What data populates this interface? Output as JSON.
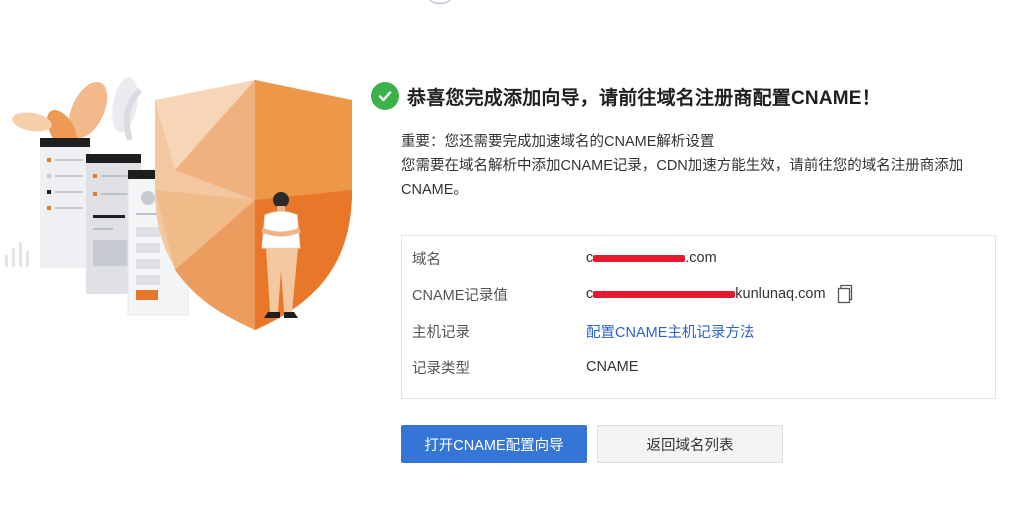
{
  "header": {
    "title": "恭喜您完成添加向导，请前往域名注册商配置CNAME！"
  },
  "notice": {
    "line1": "重要：您还需要完成加速域名的CNAME解析设置",
    "line2": "您需要在域名解析中添加CNAME记录，CDN加速方能生效，请前往您的域名注册商添加CNAME。"
  },
  "info": {
    "rows": [
      {
        "label": "域名",
        "value_prefix": "c",
        "value_suffix": ".com"
      },
      {
        "label": "CNAME记录值",
        "value_prefix": "c",
        "value_suffix": "kunlunaq.com"
      },
      {
        "label": "主机记录",
        "link": "配置CNAME主机记录方法"
      },
      {
        "label": "记录类型",
        "value": "CNAME"
      }
    ]
  },
  "actions": {
    "primary": "打开CNAME配置向导",
    "secondary": "返回域名列表"
  },
  "colors": {
    "accent": "#3575d6",
    "success": "#3bb24a",
    "link": "#2c63c9",
    "shield_light": "#f3c79f",
    "shield_dark": "#e8772a"
  },
  "icons": [
    "check-circle-icon",
    "copy-icon",
    "shield-illustration"
  ]
}
